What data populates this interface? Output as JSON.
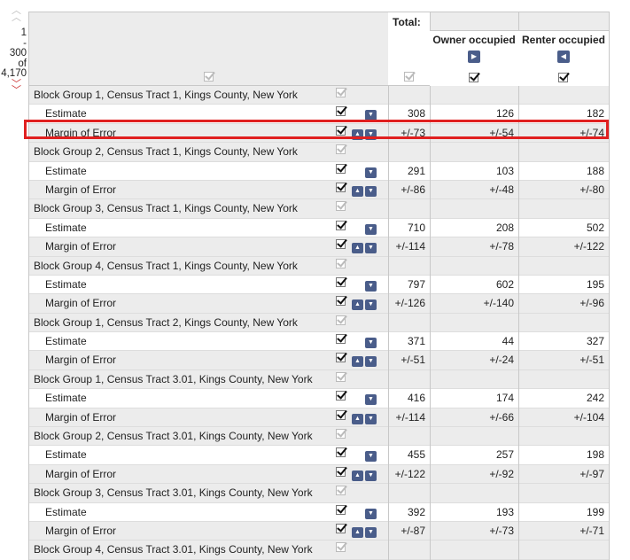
{
  "pager": {
    "start": "1",
    "dash": "-",
    "end": "300",
    "of": "of",
    "total": "4,170"
  },
  "header": {
    "total_label": "Total:",
    "owner_label": "Owner occupied",
    "renter_label": "Renter occupied"
  },
  "colors": {
    "highlight": "#e02020",
    "button": "#4a5d8a"
  },
  "rows": [
    {
      "type": "group",
      "label": "Block Group 1, Census Tract 1, Kings County, New York"
    },
    {
      "type": "item",
      "label": "Estimate",
      "total": "308",
      "owner": "126",
      "renter": "182"
    },
    {
      "type": "item",
      "label": "Margin of Error",
      "total": "+/-73",
      "owner": "+/-54",
      "renter": "+/-74"
    },
    {
      "type": "group",
      "label": "Block Group 2, Census Tract 1, Kings County, New York"
    },
    {
      "type": "item",
      "label": "Estimate",
      "total": "291",
      "owner": "103",
      "renter": "188"
    },
    {
      "type": "item",
      "label": "Margin of Error",
      "total": "+/-86",
      "owner": "+/-48",
      "renter": "+/-80"
    },
    {
      "type": "group",
      "label": "Block Group 3, Census Tract 1, Kings County, New York"
    },
    {
      "type": "item",
      "label": "Estimate",
      "total": "710",
      "owner": "208",
      "renter": "502"
    },
    {
      "type": "item",
      "label": "Margin of Error",
      "total": "+/-114",
      "owner": "+/-78",
      "renter": "+/-122"
    },
    {
      "type": "group",
      "label": "Block Group 4, Census Tract 1, Kings County, New York"
    },
    {
      "type": "item",
      "label": "Estimate",
      "total": "797",
      "owner": "602",
      "renter": "195"
    },
    {
      "type": "item",
      "label": "Margin of Error",
      "total": "+/-126",
      "owner": "+/-140",
      "renter": "+/-96"
    },
    {
      "type": "group",
      "label": "Block Group 1, Census Tract 2, Kings County, New York"
    },
    {
      "type": "item",
      "label": "Estimate",
      "total": "371",
      "owner": "44",
      "renter": "327"
    },
    {
      "type": "item",
      "label": "Margin of Error",
      "total": "+/-51",
      "owner": "+/-24",
      "renter": "+/-51"
    },
    {
      "type": "group",
      "label": "Block Group 1, Census Tract 3.01, Kings County, New York"
    },
    {
      "type": "item",
      "label": "Estimate",
      "total": "416",
      "owner": "174",
      "renter": "242"
    },
    {
      "type": "item",
      "label": "Margin of Error",
      "total": "+/-114",
      "owner": "+/-66",
      "renter": "+/-104"
    },
    {
      "type": "group",
      "label": "Block Group 2, Census Tract 3.01, Kings County, New York"
    },
    {
      "type": "item",
      "label": "Estimate",
      "total": "455",
      "owner": "257",
      "renter": "198"
    },
    {
      "type": "item",
      "label": "Margin of Error",
      "total": "+/-122",
      "owner": "+/-92",
      "renter": "+/-97"
    },
    {
      "type": "group",
      "label": "Block Group 3, Census Tract 3.01, Kings County, New York"
    },
    {
      "type": "item",
      "label": "Estimate",
      "total": "392",
      "owner": "193",
      "renter": "199"
    },
    {
      "type": "item",
      "label": "Margin of Error",
      "total": "+/-87",
      "owner": "+/-73",
      "renter": "+/-71"
    },
    {
      "type": "group",
      "label": "Block Group 4, Census Tract 3.01, Kings County, New York"
    }
  ]
}
